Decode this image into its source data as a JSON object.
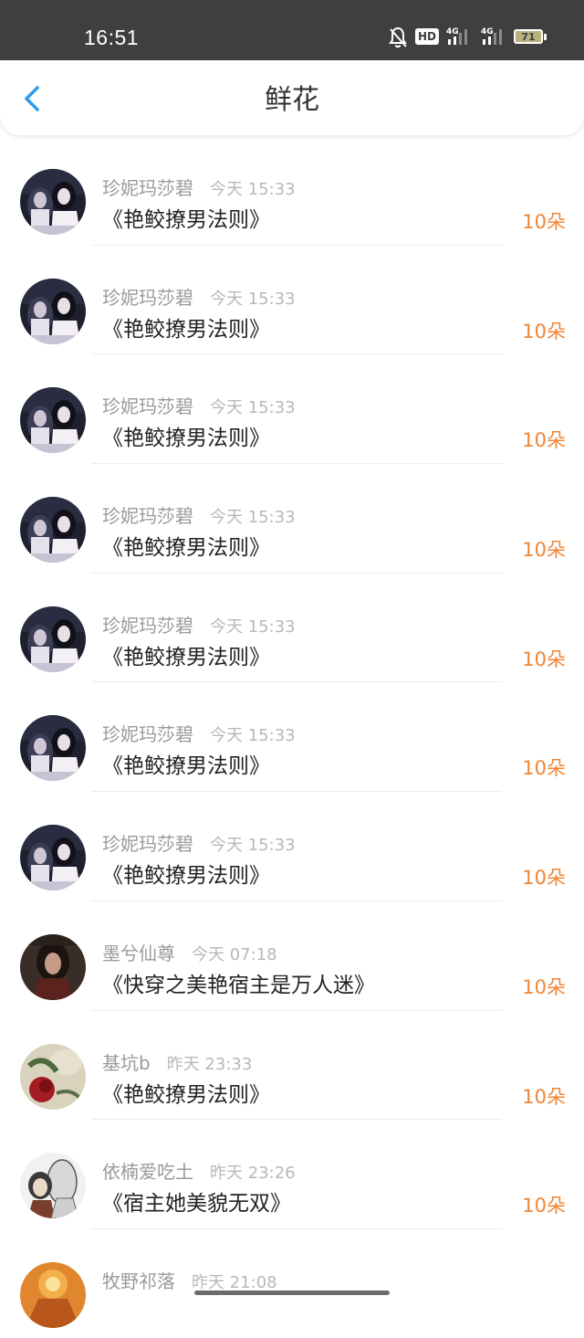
{
  "status_bar": {
    "time": "16:51",
    "hd": "HD",
    "network_1": "4G",
    "network_2": "4G",
    "battery": "71"
  },
  "header": {
    "title": "鲜花",
    "accent": "#2f9bea"
  },
  "colors": {
    "amount": "#ef8637",
    "name": "#9a9a9a",
    "time": "#b8b8b8"
  },
  "items": [
    {
      "name": "珍妮玛莎碧",
      "time": "今天 15:33",
      "book": "《艳鲛撩男法则》",
      "amount": "10朵",
      "avatar": "dark-portrait"
    },
    {
      "name": "珍妮玛莎碧",
      "time": "今天 15:33",
      "book": "《艳鲛撩男法则》",
      "amount": "10朵",
      "avatar": "dark-portrait"
    },
    {
      "name": "珍妮玛莎碧",
      "time": "今天 15:33",
      "book": "《艳鲛撩男法则》",
      "amount": "10朵",
      "avatar": "dark-portrait"
    },
    {
      "name": "珍妮玛莎碧",
      "time": "今天 15:33",
      "book": "《艳鲛撩男法则》",
      "amount": "10朵",
      "avatar": "dark-portrait"
    },
    {
      "name": "珍妮玛莎碧",
      "time": "今天 15:33",
      "book": "《艳鲛撩男法则》",
      "amount": "10朵",
      "avatar": "dark-portrait"
    },
    {
      "name": "珍妮玛莎碧",
      "time": "今天 15:33",
      "book": "《艳鲛撩男法则》",
      "amount": "10朵",
      "avatar": "dark-portrait"
    },
    {
      "name": "珍妮玛莎碧",
      "time": "今天 15:33",
      "book": "《艳鲛撩男法则》",
      "amount": "10朵",
      "avatar": "dark-portrait"
    },
    {
      "name": "墨兮仙尊",
      "time": "今天 07:18",
      "book": "《快穿之美艳宿主是万人迷》",
      "amount": "10朵",
      "avatar": "brown-portrait"
    },
    {
      "name": "基坑b",
      "time": "昨天 23:33",
      "book": "《艳鲛撩男法则》",
      "amount": "10朵",
      "avatar": "rose"
    },
    {
      "name": "依楠爱吃土",
      "time": "昨天 23:26",
      "book": "《宿主她美貌无双》",
      "amount": "10朵",
      "avatar": "sketch-couple"
    },
    {
      "name": "牧野祁落",
      "time": "昨天 21:08",
      "book": "",
      "amount": "",
      "avatar": "orange"
    }
  ]
}
